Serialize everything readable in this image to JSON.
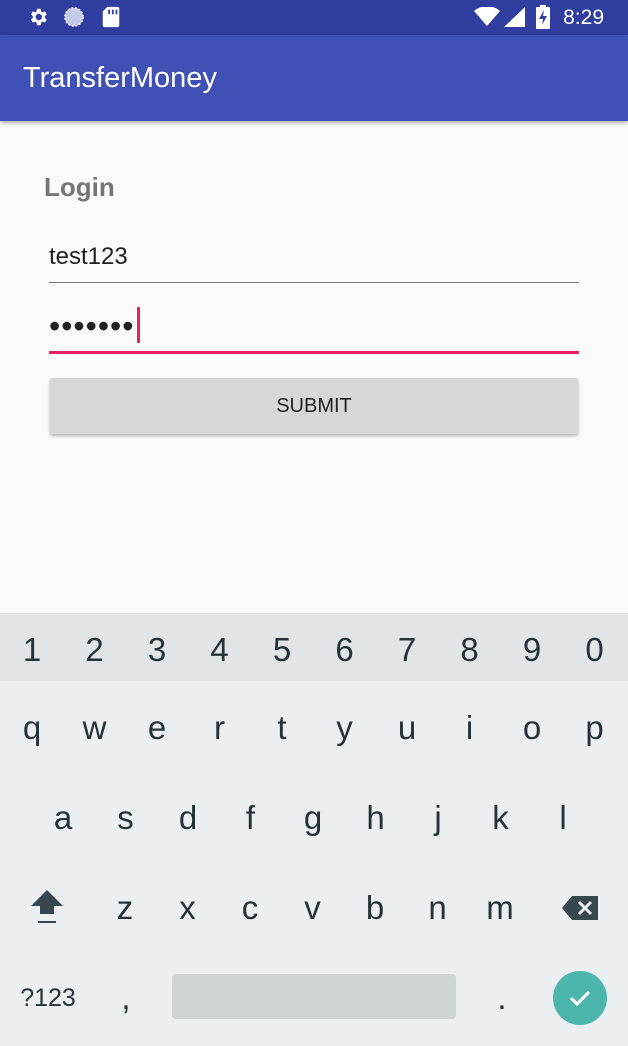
{
  "status_bar": {
    "time": "8:29",
    "icons": [
      "settings-icon",
      "sync-icon",
      "sd-card-icon",
      "wifi-icon",
      "signal-icon",
      "battery-charging-icon"
    ]
  },
  "app_bar": {
    "title": "TransferMoney"
  },
  "login": {
    "heading": "Login",
    "username_value": "test123",
    "password_value": "•••••••",
    "submit_label": "SUBMIT"
  },
  "keyboard": {
    "numbers": [
      "1",
      "2",
      "3",
      "4",
      "5",
      "6",
      "7",
      "8",
      "9",
      "0"
    ],
    "row1": [
      "q",
      "w",
      "e",
      "r",
      "t",
      "y",
      "u",
      "i",
      "o",
      "p"
    ],
    "row2": [
      "a",
      "s",
      "d",
      "f",
      "g",
      "h",
      "j",
      "k",
      "l"
    ],
    "row3": [
      "z",
      "x",
      "c",
      "v",
      "b",
      "n",
      "m"
    ],
    "symbols_label": "?123",
    "comma": ",",
    "period": "."
  },
  "colors": {
    "status_bar": "#303f9f",
    "app_bar": "#3f51b5",
    "accent": "#e91e63",
    "enter_key": "#4db6ac"
  }
}
